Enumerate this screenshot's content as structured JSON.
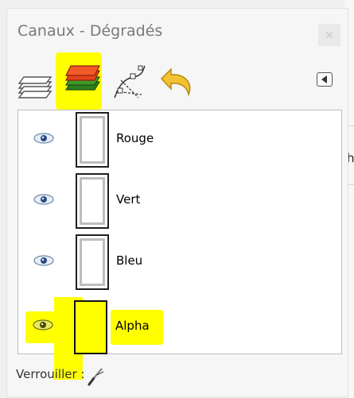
{
  "panel": {
    "title": "Canaux - Dégradés",
    "close_label": "×"
  },
  "tabs": [
    {
      "name": "layers",
      "icon": "layers-icon"
    },
    {
      "name": "channels",
      "icon": "channels-icon"
    },
    {
      "name": "paths",
      "icon": "paths-icon"
    },
    {
      "name": "undo",
      "icon": "undo-icon"
    }
  ],
  "channels": [
    {
      "label": "Rouge"
    },
    {
      "label": "Vert"
    },
    {
      "label": "Bleu"
    },
    {
      "label": "Alpha"
    }
  ],
  "footer": {
    "lock_label": "Verrouiller :"
  },
  "right_cutoff": "h",
  "colors": {
    "highlight": "#ffff00",
    "panel_bg": "#f6f6f6",
    "list_bg": "#ffffff"
  }
}
